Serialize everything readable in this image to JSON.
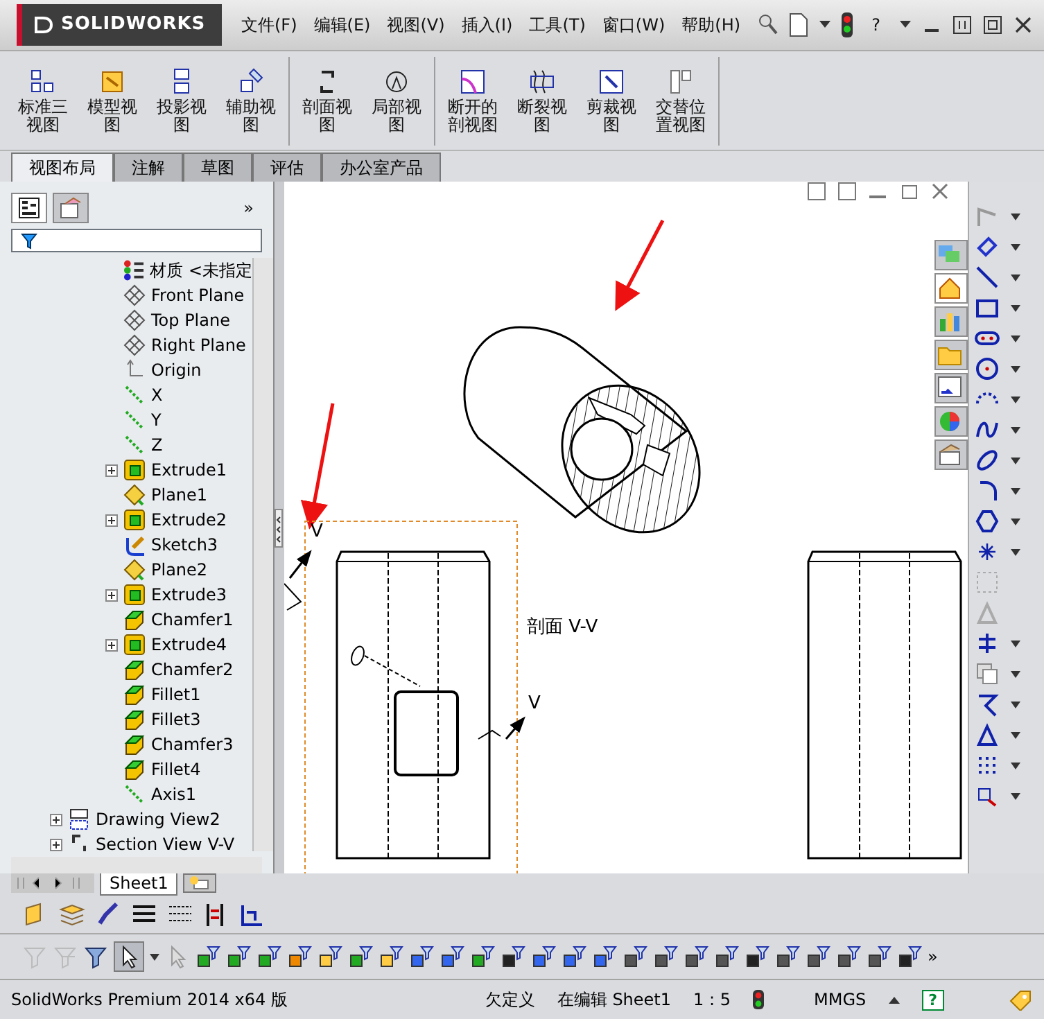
{
  "app": {
    "logo": "SOLIDWORKS"
  },
  "menu": [
    "文件(F)",
    "编辑(E)",
    "视图(V)",
    "插入(I)",
    "工具(T)",
    "窗口(W)",
    "帮助(H)"
  ],
  "title_help": "?",
  "ribbon": {
    "groups": [
      [
        "标准三视图",
        "模型视图",
        "投影视图",
        "辅助视图"
      ],
      [
        "剖面视图",
        "局部视图"
      ],
      [
        "断开的剖视图",
        "断裂视图",
        "剪裁视图",
        "交替位置视图"
      ]
    ]
  },
  "command_tabs": [
    {
      "label": "视图布局",
      "selected": true
    },
    {
      "label": "注解",
      "selected": false
    },
    {
      "label": "草图",
      "selected": false
    },
    {
      "label": "评估",
      "selected": false
    },
    {
      "label": "办公室产品",
      "selected": false
    }
  ],
  "feature_manager": {
    "tabs": [
      {
        "kind": "tree",
        "selected": true
      },
      {
        "kind": "property",
        "selected": false
      }
    ],
    "more": "»",
    "features": [
      {
        "label": "材质 <未指定",
        "kind": "material",
        "expandable": false
      },
      {
        "label": "Front Plane",
        "kind": "plane",
        "expandable": false
      },
      {
        "label": "Top Plane",
        "kind": "plane",
        "expandable": false
      },
      {
        "label": "Right Plane",
        "kind": "plane",
        "expandable": false
      },
      {
        "label": "Origin",
        "kind": "origin",
        "expandable": false
      },
      {
        "label": "X",
        "kind": "axis",
        "expandable": false
      },
      {
        "label": "Y",
        "kind": "axis",
        "expandable": false
      },
      {
        "label": "Z",
        "kind": "axis",
        "expandable": false
      },
      {
        "label": "Extrude1",
        "kind": "extrude",
        "expandable": true
      },
      {
        "label": "Plane1",
        "kind": "refplane",
        "expandable": false
      },
      {
        "label": "Extrude2",
        "kind": "extrude",
        "expandable": true
      },
      {
        "label": "Sketch3",
        "kind": "sketch",
        "expandable": false
      },
      {
        "label": "Plane2",
        "kind": "refplane",
        "expandable": false
      },
      {
        "label": "Extrude3",
        "kind": "extrude",
        "expandable": true
      },
      {
        "label": "Chamfer1",
        "kind": "chamfer",
        "expandable": false
      },
      {
        "label": "Extrude4",
        "kind": "extrude",
        "expandable": true
      },
      {
        "label": "Chamfer2",
        "kind": "chamfer",
        "expandable": false
      },
      {
        "label": "Fillet1",
        "kind": "chamfer",
        "expandable": false
      },
      {
        "label": "Fillet3",
        "kind": "chamfer",
        "expandable": false
      },
      {
        "label": "Chamfer3",
        "kind": "chamfer",
        "expandable": false
      },
      {
        "label": "Fillet4",
        "kind": "chamfer",
        "expandable": false
      },
      {
        "label": "Axis1",
        "kind": "axis",
        "expandable": false
      }
    ],
    "views": [
      {
        "label": "Drawing View2",
        "kind": "drawing-view",
        "expandable": true
      },
      {
        "label": "Section View V-V",
        "kind": "section-view",
        "expandable": true
      }
    ]
  },
  "canvas": {
    "section_title": "剖面 V-V",
    "section_mark_left": "V",
    "section_mark_right": "V"
  },
  "sheet_tabs": [
    {
      "label": "Sheet1",
      "selected": true
    }
  ],
  "selection_toolbar": {
    "pointer_pressed": true,
    "more": "»"
  },
  "status_bar": {
    "product": "SolidWorks Premium 2014 x64 版",
    "definition": "欠定义",
    "editing": "在编辑 Sheet1",
    "scale": "1 : 5",
    "units": "MMGS",
    "help": "?"
  }
}
